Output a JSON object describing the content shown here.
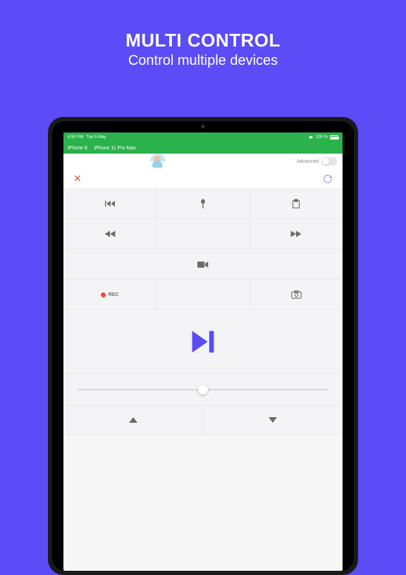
{
  "promo": {
    "title": "MULTI CONTROL",
    "subtitle": "Control multiple devices"
  },
  "status": {
    "time": "6:50 PM",
    "date": "Tue 5 May",
    "battery": "100 %"
  },
  "devices": {
    "a": "iPhone 8.",
    "b": "iPhone 11 Pro Max."
  },
  "advanced": {
    "label": "Advanced"
  },
  "rec": {
    "label": "REC"
  }
}
